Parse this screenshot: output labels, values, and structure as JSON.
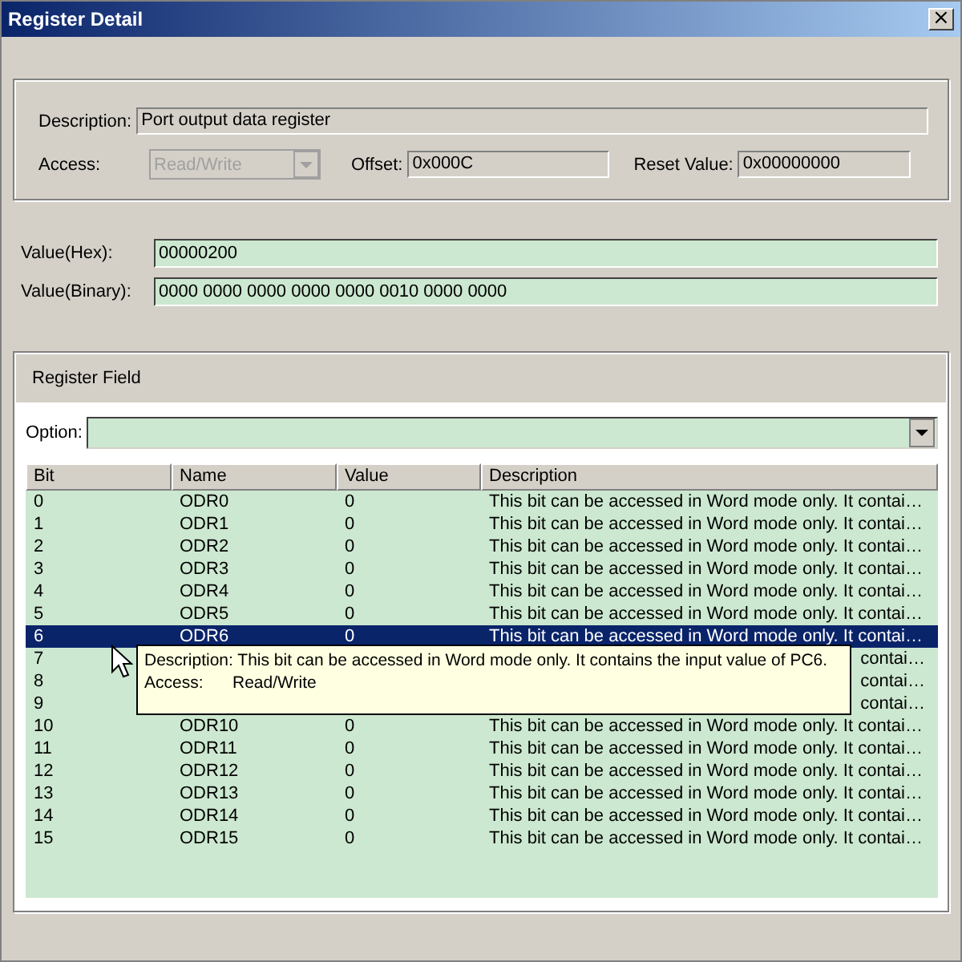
{
  "window": {
    "title": "Register Detail",
    "close": "×"
  },
  "register": {
    "description_label": "Description:",
    "description": "Port output data register",
    "access_label": "Access:",
    "access": "Read/Write",
    "access_disabled": true,
    "offset_label": "Offset:",
    "offset": "0x000C",
    "reset_label": "Reset Value:",
    "reset": "0x00000000"
  },
  "value": {
    "hex_label": "Value(Hex):",
    "hex": "00000200",
    "binary_label": "Value(Binary):",
    "binary": "0000 0000 0000 0000 0000 0010 0000 0000"
  },
  "register_field": {
    "title": "Register Field",
    "option_label": "Option:",
    "columns": [
      "Bit",
      "Name",
      "Value",
      "Description"
    ],
    "rows": [
      {
        "kind": "full",
        "bit": "0",
        "name": "ODR0",
        "value": "0",
        "description": "This bit can be accessed in Word mode only. It contai…",
        "selected": false
      },
      {
        "kind": "full",
        "bit": "1",
        "name": "ODR1",
        "value": "0",
        "description": "This bit can be accessed in Word mode only. It contai…",
        "selected": false
      },
      {
        "kind": "full",
        "bit": "2",
        "name": "ODR2",
        "value": "0",
        "description": "This bit can be accessed in Word mode only. It contai…",
        "selected": false
      },
      {
        "kind": "full",
        "bit": "3",
        "name": "ODR3",
        "value": "0",
        "description": "This bit can be accessed in Word mode only. It contai…",
        "selected": false
      },
      {
        "kind": "full",
        "bit": "4",
        "name": "ODR4",
        "value": "0",
        "description": "This bit can be accessed in Word mode only. It contai…",
        "selected": false
      },
      {
        "kind": "full",
        "bit": "5",
        "name": "ODR5",
        "value": "0",
        "description": "This bit can be accessed in Word mode only. It contai…",
        "selected": false
      },
      {
        "kind": "full",
        "bit": "6",
        "name": "ODR6",
        "value": "0",
        "description": "This bit can be accessed in Word mode only. It contai…",
        "selected": true
      },
      {
        "kind": "partial",
        "bit": "7",
        "description": "contai…",
        "selected": false
      },
      {
        "kind": "partial",
        "bit": "8",
        "description": "contai…",
        "selected": false
      },
      {
        "kind": "partial",
        "bit": "9",
        "description": "contai…",
        "selected": false
      },
      {
        "kind": "full",
        "bit": "10",
        "name": "ODR10",
        "value": "0",
        "description": "This bit can be accessed in Word mode only. It contai…",
        "selected": false
      },
      {
        "kind": "full",
        "bit": "11",
        "name": "ODR11",
        "value": "0",
        "description": "This bit can be accessed in Word mode only. It contai…",
        "selected": false
      },
      {
        "kind": "full",
        "bit": "12",
        "name": "ODR12",
        "value": "0",
        "description": "This bit can be accessed in Word mode only. It contai…",
        "selected": false
      },
      {
        "kind": "full",
        "bit": "13",
        "name": "ODR13",
        "value": "0",
        "description": "This bit can be accessed in Word mode only. It contai…",
        "selected": false
      },
      {
        "kind": "full",
        "bit": "14",
        "name": "ODR14",
        "value": "0",
        "description": "This bit can be accessed in Word mode only. It contai…",
        "selected": false
      },
      {
        "kind": "full",
        "bit": "15",
        "name": "ODR15",
        "value": "0",
        "description": "This bit can be accessed in Word mode only. It contai…",
        "selected": false
      }
    ],
    "tooltip": {
      "description_label": "Description:",
      "description": "This bit can be accessed in Word mode only. It contains the input value of PC6.",
      "access_label": "Access:",
      "access": "Read/Write"
    }
  }
}
